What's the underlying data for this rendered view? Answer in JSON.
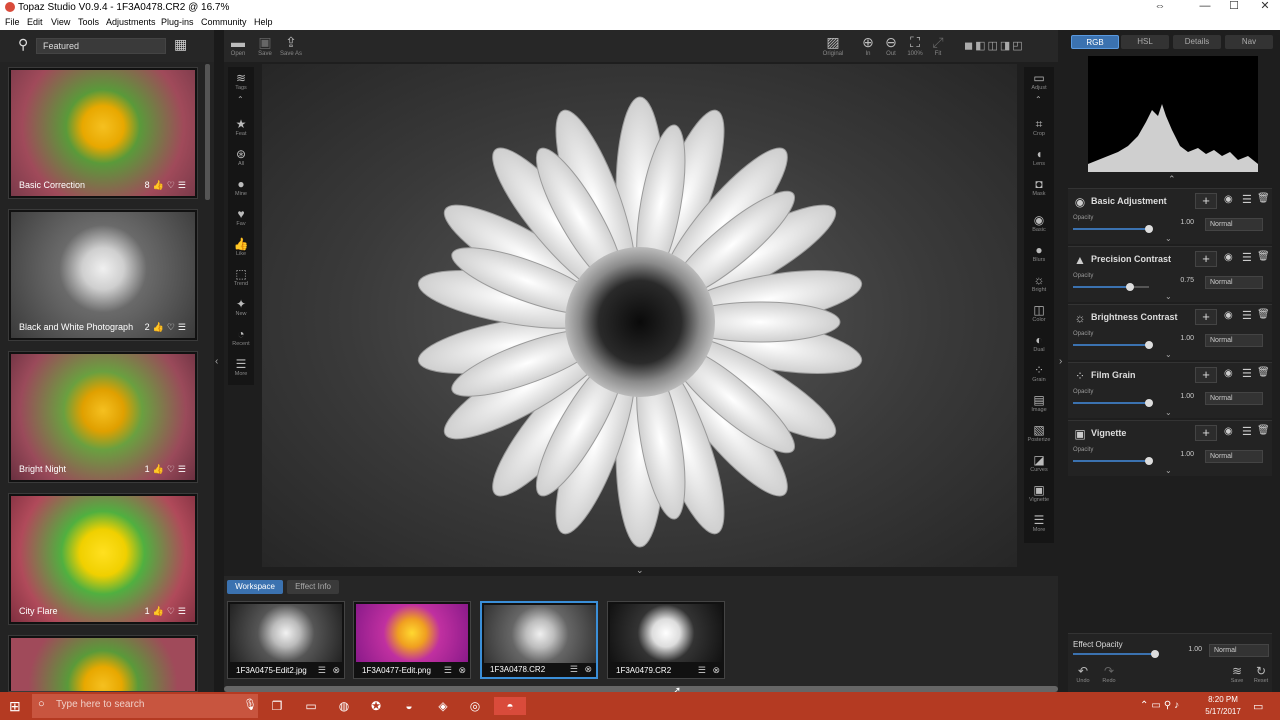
{
  "window": {
    "title": "Topaz Studio V0.9.4 - 1F3A0478.CR2 @ 16.7%"
  },
  "menu": [
    "File",
    "Edit",
    "View",
    "Tools",
    "Adjustments",
    "Plug-ins",
    "Community",
    "Help"
  ],
  "search": {
    "value": "Featured"
  },
  "presets": [
    {
      "label": "Basic Correction",
      "count": "8"
    },
    {
      "label": "Black and White Photograph",
      "count": "2"
    },
    {
      "label": "Bright Night",
      "count": "1"
    },
    {
      "label": "City Flare",
      "count": "1"
    }
  ],
  "toolbar": {
    "open": "Open",
    "save": "Save",
    "save_as": "Save As",
    "original": "Original",
    "in": "In",
    "out": "Out",
    "zoom100": "100%",
    "fit": "Fit"
  },
  "left_tools": [
    "Tags",
    "Feat",
    "All",
    "Mine",
    "Fav",
    "Like",
    "Trend",
    "New",
    "Recent",
    "More"
  ],
  "right_tools": [
    "Adjust",
    "Crop",
    "Lens",
    "Mask",
    "Basic",
    "Blurs",
    "Bright",
    "Color",
    "Dual",
    "Grain",
    "Image",
    "Posterize",
    "Curves",
    "Vignette",
    "More"
  ],
  "bottom_tabs": {
    "workspace": "Workspace",
    "effect_info": "Effect Info"
  },
  "filmstrip": [
    {
      "name": "1F3A0475-Edit2.jpg"
    },
    {
      "name": "1F3A0477-Edit.png"
    },
    {
      "name": "1F3A0478.CR2"
    },
    {
      "name": "1F3A0479.CR2"
    }
  ],
  "right_tabs": [
    "RGB",
    "HSL",
    "Details",
    "Nav"
  ],
  "effects": [
    {
      "name": "Basic Adjustment",
      "opacity_label": "Opacity",
      "value": "1.00",
      "opacity": 1.0,
      "blend": "Normal"
    },
    {
      "name": "Precision Contrast",
      "opacity_label": "Opacity",
      "value": "0.75",
      "opacity": 0.75,
      "blend": "Normal"
    },
    {
      "name": "Brightness Contrast",
      "opacity_label": "Opacity",
      "value": "1.00",
      "opacity": 1.0,
      "blend": "Normal"
    },
    {
      "name": "Film Grain",
      "opacity_label": "Opacity",
      "value": "1.00",
      "opacity": 1.0,
      "blend": "Normal"
    },
    {
      "name": "Vignette",
      "opacity_label": "Opacity",
      "value": "1.00",
      "opacity": 1.0,
      "blend": "Normal"
    }
  ],
  "effect_opacity": {
    "label": "Effect Opacity",
    "value": "1.00",
    "opacity": 1.0,
    "blend": "Normal",
    "undo": "Undo",
    "redo": "Redo",
    "save": "Save",
    "reset": "Reset"
  },
  "taskbar": {
    "search_placeholder": "Type here to search",
    "time": "8:20 PM",
    "date": "5/17/2017"
  }
}
